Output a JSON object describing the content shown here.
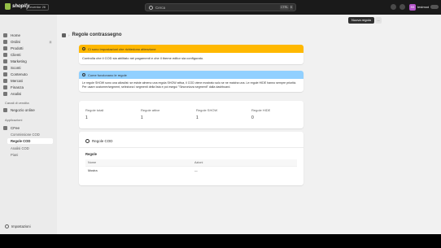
{
  "topbar": {
    "logo_text": "shopify",
    "plan_badge": "Inventor 26",
    "search_placeholder": "Cerca",
    "search_shortcut_1": "CTRL",
    "search_shortcut_2": "K",
    "store_initials": "SS",
    "store_name": "testmod"
  },
  "sidebar": {
    "items": [
      {
        "label": "Home",
        "icon": "home-icon"
      },
      {
        "label": "Ordini",
        "icon": "orders-icon",
        "count": "0"
      },
      {
        "label": "Prodotti",
        "icon": "tag-icon"
      },
      {
        "label": "Clienti",
        "icon": "person-icon"
      },
      {
        "label": "Marketing",
        "icon": "target-icon"
      },
      {
        "label": "Sconti",
        "icon": "discount-icon"
      },
      {
        "label": "Contenuto",
        "icon": "content-icon"
      },
      {
        "label": "Mercati",
        "icon": "globe-icon"
      },
      {
        "label": "Finanza",
        "icon": "finance-icon"
      },
      {
        "label": "Analisi",
        "icon": "chart-icon"
      }
    ],
    "sales_channels_title": "Canali di vendita",
    "online_store": "Negozio online",
    "apps_title": "Applicazioni",
    "app_name": "CFee",
    "app_subitems": [
      "Commissione COD",
      "Regole COD",
      "Analisi COD",
      "Piani"
    ],
    "settings_label": "Impostazioni"
  },
  "page": {
    "title": "Regole contrassegno",
    "primary_button": "Nuova regola",
    "more_button": "..."
  },
  "warning_banner": {
    "title": "Ci sono impostazioni che richiedono attenzione",
    "body": "Controlla che il COD sia abilitato nei pagamenti e che il theme editor sia configurato."
  },
  "info_banner": {
    "title": "Come funzionano le regole",
    "body": "Le regole SHOW sono una allowlist: se esiste almeno una regola SHOW attiva, il COD viene mostrato solo se ne matcha una. Le regole HIDE hanno sempre priorità. Per usare customer/segment, seleziona i segmenti della lista e poi esegui \"Sincronizza segmenti\" dalla dashboard."
  },
  "stats": [
    {
      "label": "Regole totali",
      "value": "1"
    },
    {
      "label": "Regole attive",
      "value": "1"
    },
    {
      "label": "Regole SHOW",
      "value": "1"
    },
    {
      "label": "Regole HIDE",
      "value": "0"
    }
  ],
  "cod_rules": {
    "title": "Regole COD",
    "subtitle": "Regole",
    "columns": [
      "Nome",
      "Azioni"
    ],
    "rows": [
      {
        "name": "Mostra",
        "actions": "—"
      }
    ]
  }
}
